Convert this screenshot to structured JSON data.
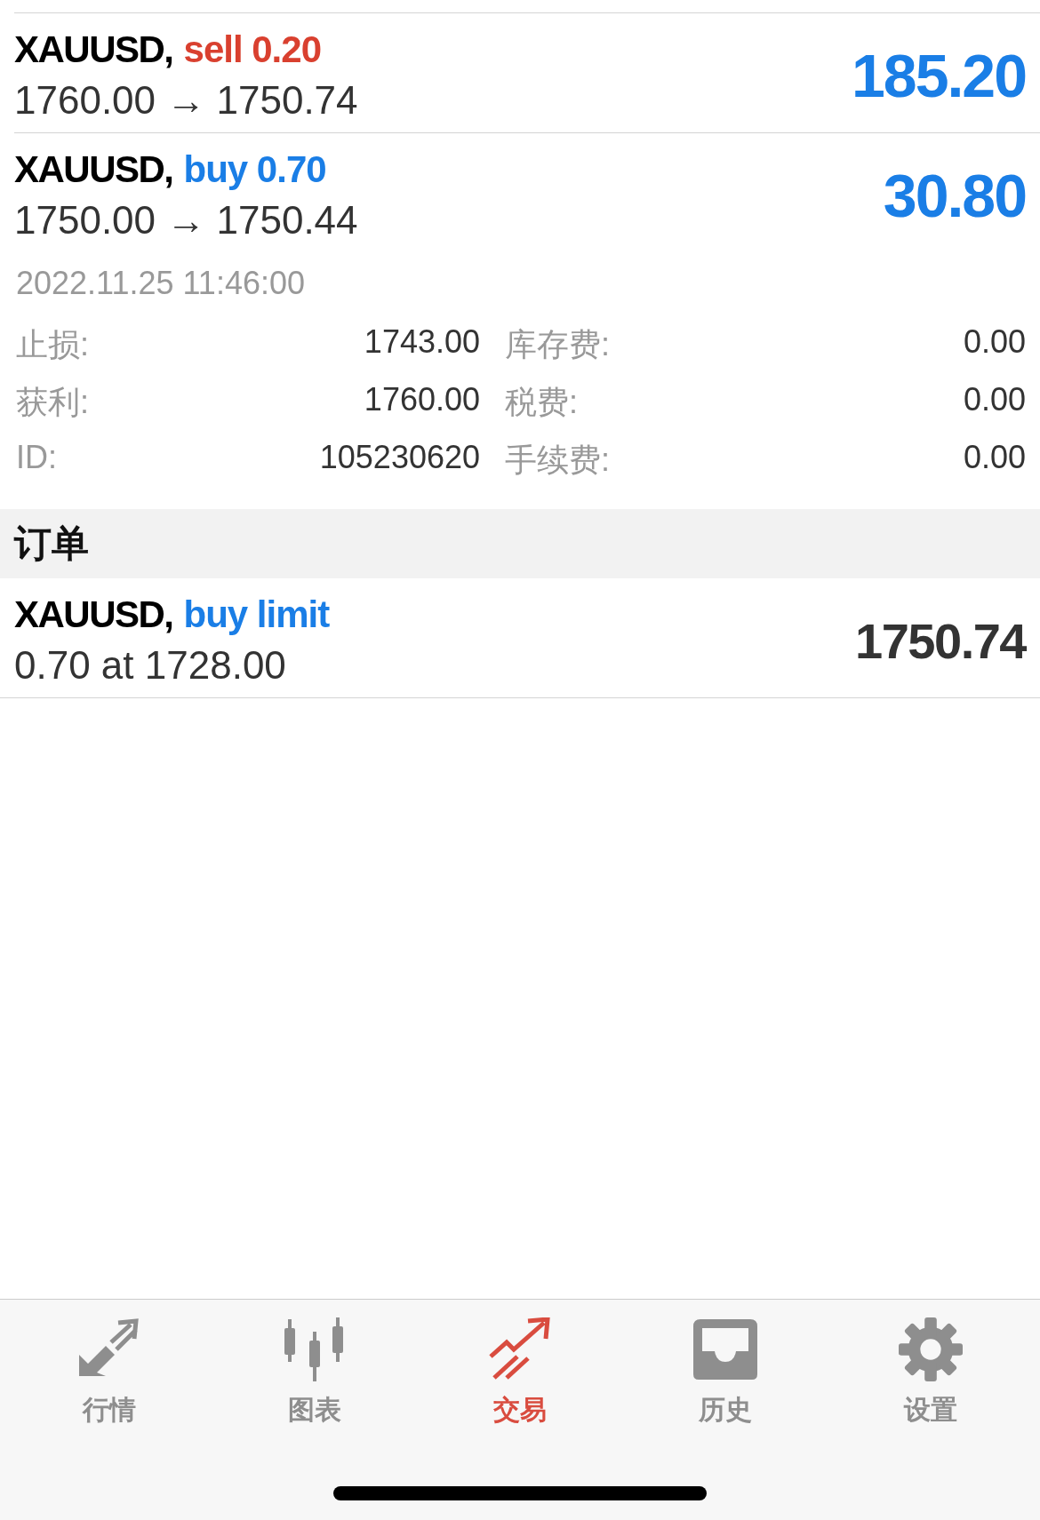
{
  "positions": [
    {
      "symbol": "XAUUSD,",
      "action": "sell 0.20",
      "kind": "sell",
      "prices": "1760.00 → 1750.74",
      "profit": "185.20",
      "expanded": false
    },
    {
      "symbol": "XAUUSD,",
      "action": "buy 0.70",
      "kind": "buy",
      "prices": "1750.00 → 1750.44",
      "profit": "30.80",
      "expanded": true,
      "time": "2022.11.25 11:46:00",
      "details": [
        {
          "label": "止损:",
          "value": "1743.00",
          "label_2": "库存费:",
          "value_2": "0.00"
        },
        {
          "label": "获利:",
          "value": "1760.00",
          "label_2": "税费:",
          "value_2": "0.00"
        },
        {
          "label": "ID:",
          "value": "105230620",
          "label_2": "手续费:",
          "value_2": "0.00"
        }
      ]
    }
  ],
  "orders_header": "订单",
  "orders": [
    {
      "symbol": "XAUUSD,",
      "action": "buy limit",
      "kind": "buy",
      "prices": "0.70 at 1728.00",
      "price": "1750.74"
    }
  ],
  "tabs": [
    {
      "label": "行情",
      "kind": "quotes",
      "selected": false
    },
    {
      "label": "图表",
      "kind": "chart",
      "selected": false
    },
    {
      "label": "交易",
      "kind": "trade",
      "selected": true
    },
    {
      "label": "历史",
      "kind": "history",
      "selected": false
    },
    {
      "label": "设置",
      "kind": "settings",
      "selected": false
    }
  ]
}
